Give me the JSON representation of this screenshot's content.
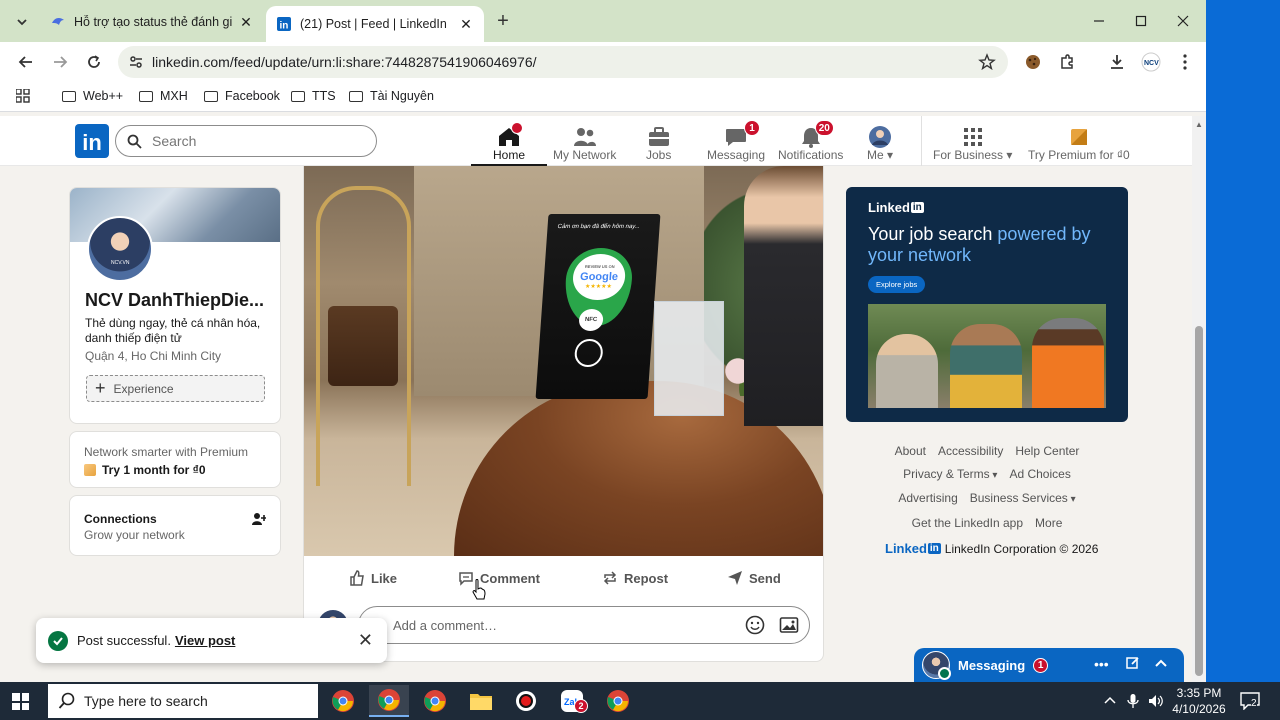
{
  "browser": {
    "tabs": [
      {
        "title": "Hỗ trợ tạo status thẻ đánh giá Google"
      },
      {
        "title": "(21) Post | Feed | LinkedIn"
      }
    ],
    "url": "linkedin.com/feed/update/urn:li:share:7448287541906046976/",
    "bookmarks": [
      "Web++",
      "MXH",
      "Facebook",
      "TTS",
      "Tài Nguyên"
    ]
  },
  "linkedin": {
    "search_placeholder": "Search",
    "nav": [
      {
        "label": "Home",
        "badge": ""
      },
      {
        "label": "My Network",
        "badge": ""
      },
      {
        "label": "Jobs",
        "badge": ""
      },
      {
        "label": "Messaging",
        "badge": "1"
      },
      {
        "label": "Notifications",
        "badge": "20"
      },
      {
        "label": "Me",
        "badge": ""
      },
      {
        "label": "For Business",
        "badge": ""
      },
      {
        "label": "Try Premium for ₫0",
        "badge": ""
      }
    ],
    "profile": {
      "name": "NCV DanhThiepDie...",
      "headline": "Thẻ dùng ngay, thẻ cá nhân hóa, danh thiếp điện tử",
      "location": "Quận 4, Ho Chi Minh City",
      "experience_label": "Experience",
      "logo_text": "NCV.VN"
    },
    "premium": {
      "line1": "Network smarter with Premium",
      "line2": "Try 1 month for ₫0"
    },
    "connections": {
      "title": "Connections",
      "subtitle": "Grow your network"
    },
    "post": {
      "image_text": {
        "stand_caption": "Cảm ơn bạn đã đến hôm nay...",
        "review_label": "REVIEW US ON",
        "google": "Google",
        "stars": "★★★★★",
        "nfc": "NFC"
      },
      "actions": [
        "Like",
        "Comment",
        "Repost",
        "Send"
      ],
      "comment_placeholder": "Add a comment…"
    },
    "ad": {
      "logo": "Linked",
      "logo_in": "in",
      "headline_plain": "Your job search ",
      "headline_highlight": "powered by your network",
      "button": "Explore jobs"
    },
    "footer": {
      "row1": [
        "About",
        "Accessibility",
        "Help Center"
      ],
      "row2": [
        "Privacy & Terms",
        "Ad Choices"
      ],
      "row3": [
        "Advertising",
        "Business Services"
      ],
      "row4": [
        "Get the LinkedIn app",
        "More"
      ],
      "brand": "Linked",
      "brand_in": "in",
      "copyright": "LinkedIn Corporation © 2026"
    },
    "toast": {
      "message": "Post successful.",
      "link": "View post"
    },
    "messaging": {
      "title": "Messaging",
      "badge": "1"
    }
  },
  "taskbar": {
    "search_placeholder": "Type here to search",
    "time": "3:35 PM",
    "date": "4/10/2026",
    "notification_count": "2",
    "zalo_badge": "2"
  },
  "colors": {
    "linkedin_blue": "#0a66c2",
    "badge_red": "#cb112d",
    "tabbar_green": "#d3e3c8",
    "ad_bg": "#0e2a47",
    "success_green": "#057642"
  }
}
